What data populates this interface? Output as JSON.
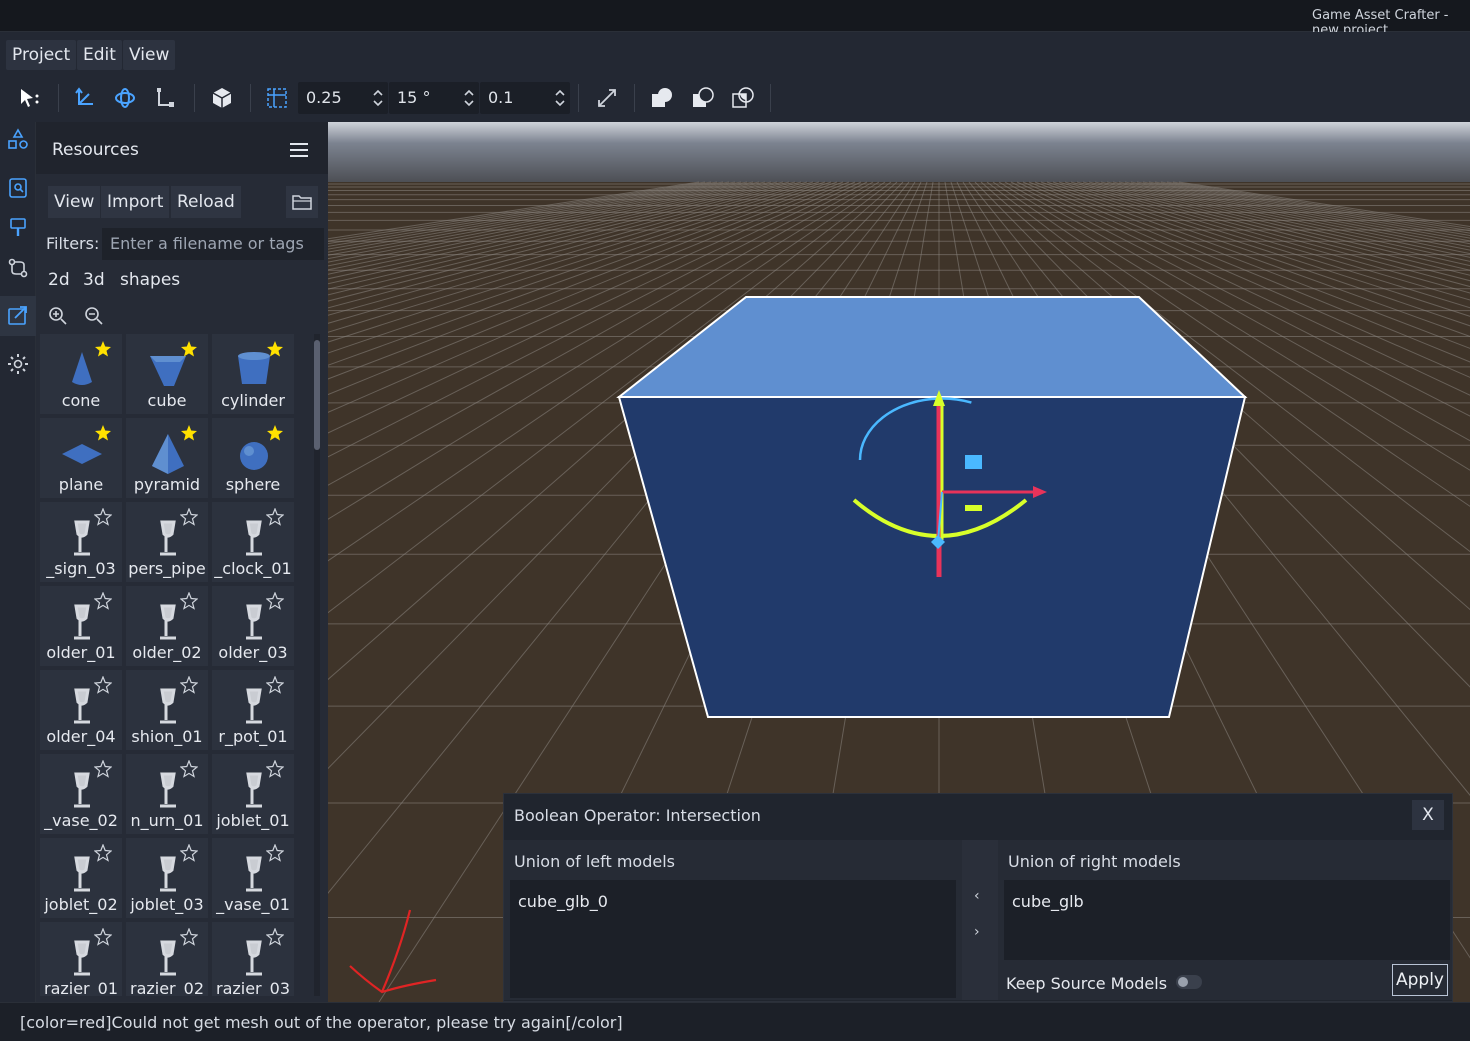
{
  "window": {
    "title": "Game Asset Crafter - new project"
  },
  "menu": {
    "items": [
      "Project",
      "Edit",
      "View"
    ]
  },
  "toolbar": {
    "snap_translate": "0.25",
    "snap_rotate": "15 °",
    "snap_scale": "0.1"
  },
  "resources": {
    "title": "Resources",
    "buttons": {
      "view": "View",
      "import": "Import",
      "reload": "Reload"
    },
    "filters_label": "Filters:",
    "filters_placeholder": "Enter a filename or tags",
    "tags": [
      "2d",
      "3d",
      "shapes"
    ],
    "assets": [
      {
        "label": "cone",
        "starred": true
      },
      {
        "label": "cube",
        "starred": true
      },
      {
        "label": "cylinder",
        "starred": true
      },
      {
        "label": "plane",
        "starred": true
      },
      {
        "label": "pyramid",
        "starred": true
      },
      {
        "label": "sphere",
        "starred": true
      },
      {
        "label": "_sign_03",
        "starred": false
      },
      {
        "label": "pers_pipe",
        "starred": false
      },
      {
        "label": "_clock_01",
        "starred": false
      },
      {
        "label": "older_01",
        "starred": false
      },
      {
        "label": "older_02",
        "starred": false
      },
      {
        "label": "older_03",
        "starred": false
      },
      {
        "label": "older_04",
        "starred": false
      },
      {
        "label": "shion_01",
        "starred": false
      },
      {
        "label": "r_pot_01",
        "starred": false
      },
      {
        "label": "_vase_02",
        "starred": false
      },
      {
        "label": "n_urn_01",
        "starred": false
      },
      {
        "label": "joblet_01",
        "starred": false
      },
      {
        "label": "joblet_02",
        "starred": false
      },
      {
        "label": "joblet_03",
        "starred": false
      },
      {
        "label": "_vase_01",
        "starred": false
      },
      {
        "label": "razier_01",
        "starred": false
      },
      {
        "label": "razier_02",
        "starred": false
      },
      {
        "label": "razier_03",
        "starred": false
      }
    ]
  },
  "boolean_panel": {
    "title": "Boolean Operator: Intersection",
    "close_label": "X",
    "left_label": "Union of left models",
    "left_items": [
      "cube_glb_0"
    ],
    "right_label": "Union of right models",
    "right_items": [
      "cube_glb"
    ],
    "move_left": "‹",
    "move_right": "›",
    "keep_source_label": "Keep Source Models",
    "keep_source_on": false,
    "apply_label": "Apply"
  },
  "status": {
    "message": "[color=red]Could not get mesh out of the operator, please try again[/color]"
  },
  "colors": {
    "accent": "#4aa3ff",
    "cube_top": "#5f8fd0",
    "cube_front": "#213a6b",
    "floor": "#3f3429"
  }
}
